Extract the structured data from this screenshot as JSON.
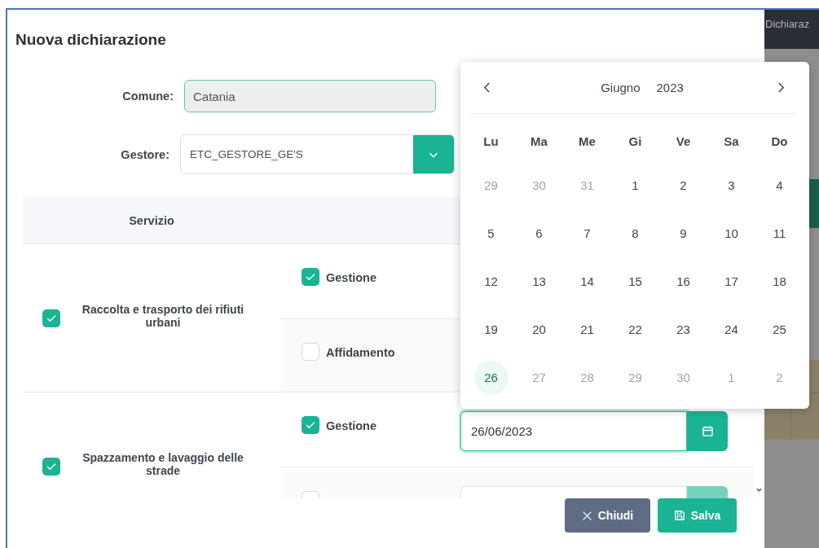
{
  "background": {
    "header_text": "Dichiaraz"
  },
  "dialog": {
    "title": "Nuova dichiarazione",
    "comune": {
      "label": "Comune:",
      "value": "Catania"
    },
    "gestore": {
      "label": "Gestore:",
      "value": "ETC_GESTORE_GE'S"
    },
    "table": {
      "columns": [
        "Servizio"
      ],
      "rows": [
        {
          "service": "Raccolta e trasporto dei rifiuti urbani",
          "checked": true,
          "options": [
            {
              "label": "Gestione",
              "checked": true,
              "kind": "plain"
            },
            {
              "label": "Affidamento",
              "checked": false,
              "kind": "plain"
            }
          ]
        },
        {
          "service": "Spazzamento e lavaggio delle strade",
          "checked": true,
          "options": [
            {
              "label": "Gestione",
              "checked": true,
              "kind": "date",
              "value": "26/06/2023"
            },
            {
              "checked": false,
              "kind": "date"
            }
          ]
        }
      ]
    },
    "buttons": [
      {
        "label": "Chiudi",
        "kind": "close"
      },
      {
        "label": "Salva",
        "kind": "save"
      }
    ]
  },
  "datepicker": {
    "month": "Giugno",
    "year": "2023",
    "weekdays": [
      "Lu",
      "Ma",
      "Me",
      "Gi",
      "Ve",
      "Sa",
      "Do"
    ],
    "days": [
      {
        "day": "29",
        "outside": true,
        "selected": false
      },
      {
        "day": "30",
        "outside": true,
        "selected": false
      },
      {
        "day": "31",
        "outside": true,
        "selected": false
      },
      {
        "day": "1",
        "outside": false,
        "selected": false
      },
      {
        "day": "2",
        "outside": false,
        "selected": false
      },
      {
        "day": "3",
        "outside": false,
        "selected": false
      },
      {
        "day": "4",
        "outside": false,
        "selected": false
      },
      {
        "day": "5",
        "outside": false,
        "selected": false
      },
      {
        "day": "6",
        "outside": false,
        "selected": false
      },
      {
        "day": "7",
        "outside": false,
        "selected": false
      },
      {
        "day": "8",
        "outside": false,
        "selected": false
      },
      {
        "day": "9",
        "outside": false,
        "selected": false
      },
      {
        "day": "10",
        "outside": false,
        "selected": false
      },
      {
        "day": "11",
        "outside": false,
        "selected": false
      },
      {
        "day": "12",
        "outside": false,
        "selected": false
      },
      {
        "day": "13",
        "outside": false,
        "selected": false
      },
      {
        "day": "14",
        "outside": false,
        "selected": false
      },
      {
        "day": "15",
        "outside": false,
        "selected": false
      },
      {
        "day": "16",
        "outside": false,
        "selected": false
      },
      {
        "day": "17",
        "outside": false,
        "selected": false
      },
      {
        "day": "18",
        "outside": false,
        "selected": false
      },
      {
        "day": "19",
        "outside": false,
        "selected": false
      },
      {
        "day": "20",
        "outside": false,
        "selected": false
      },
      {
        "day": "21",
        "outside": false,
        "selected": false
      },
      {
        "day": "22",
        "outside": false,
        "selected": false
      },
      {
        "day": "23",
        "outside": false,
        "selected": false
      },
      {
        "day": "24",
        "outside": false,
        "selected": false
      },
      {
        "day": "25",
        "outside": false,
        "selected": false
      },
      {
        "day": "26",
        "outside": false,
        "selected": true
      },
      {
        "day": "27",
        "outside": true,
        "selected": false
      },
      {
        "day": "28",
        "outside": true,
        "selected": false
      },
      {
        "day": "29",
        "outside": true,
        "selected": false
      },
      {
        "day": "30",
        "outside": true,
        "selected": false
      },
      {
        "day": "1",
        "outside": true,
        "selected": false
      },
      {
        "day": "2",
        "outside": true,
        "selected": false
      }
    ]
  }
}
